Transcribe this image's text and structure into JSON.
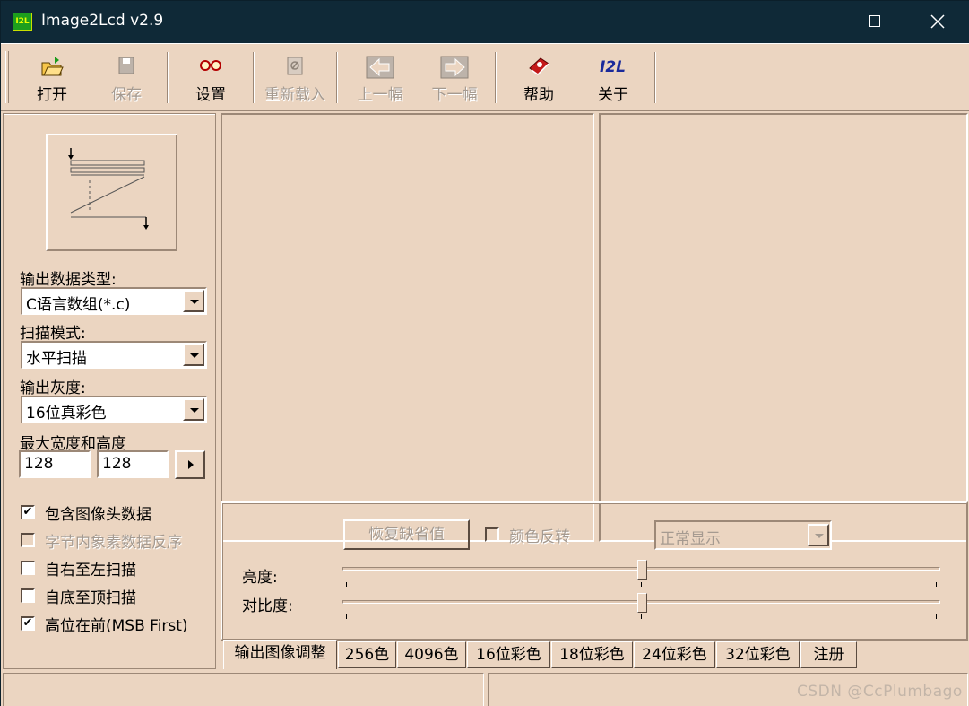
{
  "window": {
    "icon_text": "I2L",
    "title": "Image2Lcd v2.9"
  },
  "toolbar": {
    "items": [
      {
        "label": "打开",
        "icon": "open-folder-icon",
        "enabled": true
      },
      {
        "label": "保存",
        "icon": "save-icon",
        "enabled": false
      },
      {
        "label": "设置",
        "icon": "glasses-icon",
        "enabled": true
      },
      {
        "label": "重新载入",
        "icon": "reload-icon",
        "enabled": false
      },
      {
        "label": "上一幅",
        "icon": "prev-arrow-icon",
        "enabled": false
      },
      {
        "label": "下一幅",
        "icon": "next-arrow-icon",
        "enabled": false
      },
      {
        "label": "帮助",
        "icon": "help-book-icon",
        "enabled": true
      },
      {
        "label": "关于",
        "icon": "i2l-logo-icon",
        "enabled": true
      }
    ]
  },
  "left_panel": {
    "output_type_label": "输出数据类型:",
    "output_type_value": "C语言数组(*.c)",
    "scan_mode_label": "扫描模式:",
    "scan_mode_value": "水平扫描",
    "gray_label": "输出灰度:",
    "gray_value": "16位真彩色",
    "size_label": "最大宽度和高度",
    "width": "128",
    "height": "128",
    "checkboxes": [
      {
        "label": "包含图像头数据",
        "checked": true,
        "enabled": true
      },
      {
        "label": "字节内象素数据反序",
        "checked": false,
        "enabled": false
      },
      {
        "label": "自右至左扫描",
        "checked": false,
        "enabled": true
      },
      {
        "label": "自底至顶扫描",
        "checked": false,
        "enabled": true
      },
      {
        "label": "高位在前(MSB First)",
        "checked": true,
        "enabled": true
      }
    ]
  },
  "adjust": {
    "restore_button": "恢复缺省值",
    "invert_label": "颜色反转",
    "display_mode": "正常显示",
    "brightness_label": "亮度:",
    "contrast_label": "对比度:",
    "brightness_level": 0.5,
    "contrast_level": 0.5
  },
  "tabs": [
    "输出图像调整",
    "256色",
    "4096色",
    "16位彩色",
    "18位彩色",
    "24位彩色",
    "32位彩色",
    "注册"
  ],
  "watermark": "CSDN @CcPlumbago",
  "colors": {
    "window_bg": "#ebd5c1",
    "titlebar": "#0f2937",
    "disabled_text": "#a59a90"
  }
}
